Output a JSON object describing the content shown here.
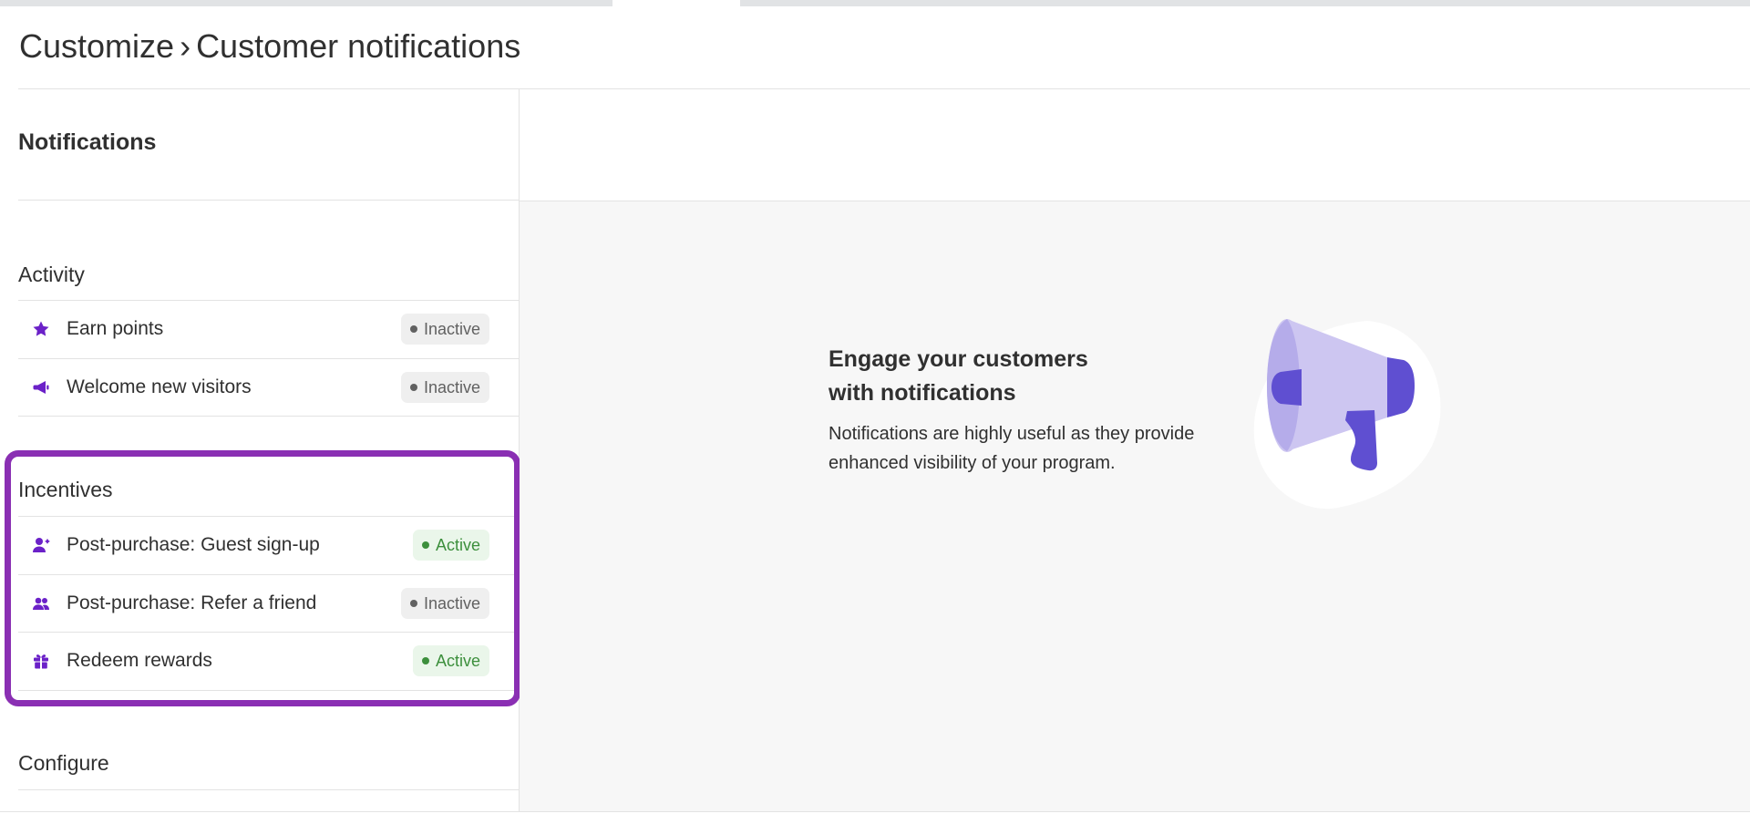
{
  "breadcrumb": {
    "parent": "Customize",
    "separator": "›",
    "current": "Customer notifications"
  },
  "sidebar": {
    "title": "Notifications",
    "sections": [
      {
        "label": "Activity",
        "items": [
          {
            "label": "Earn points",
            "icon": "star-icon",
            "status": "Inactive"
          },
          {
            "label": "Welcome new visitors",
            "icon": "megaphone-icon",
            "status": "Inactive"
          }
        ]
      },
      {
        "label": "Incentives",
        "items": [
          {
            "label": "Post-purchase: Guest sign-up",
            "icon": "user-add-icon",
            "status": "Active"
          },
          {
            "label": "Post-purchase: Refer a friend",
            "icon": "users-icon",
            "status": "Inactive"
          },
          {
            "label": "Redeem rewards",
            "icon": "gift-icon",
            "status": "Active"
          }
        ]
      },
      {
        "label": "Configure",
        "items": []
      }
    ]
  },
  "empty_state": {
    "title": "Engage your customers with notifications",
    "description": "Notifications are highly useful as they provide enhanced visibility of your program.",
    "illustration": "megaphone-illustration"
  },
  "colors": {
    "accent": "#6b21c8",
    "highlight_border": "#8a2fb3",
    "active_text": "#3c8f3c",
    "active_bg": "#eaf6ea",
    "inactive_text": "#616161",
    "inactive_bg": "#efefef",
    "illustration_light": "#cdc6f1",
    "illustration_dark": "#5f4fd1"
  }
}
